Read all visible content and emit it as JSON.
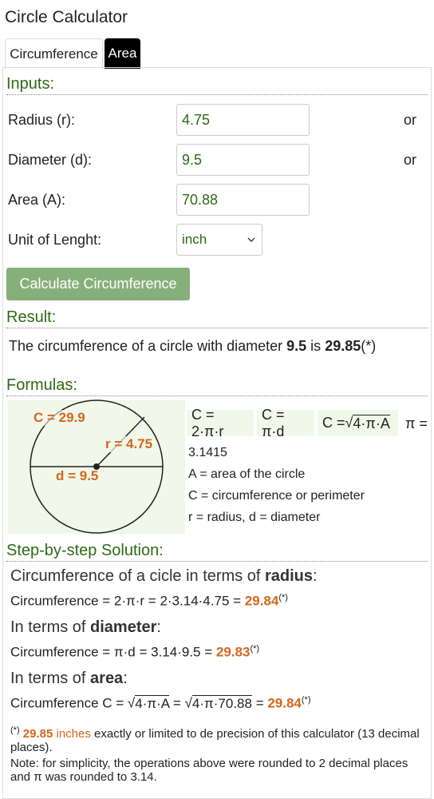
{
  "app": {
    "title": "Circle Calculator"
  },
  "tabs": [
    {
      "label": "Circumference",
      "active": true
    },
    {
      "label": "Area",
      "active": false
    }
  ],
  "inputs": {
    "heading": "Inputs:",
    "radius": {
      "label": "Radius (r):",
      "value": "4.75"
    },
    "diameter": {
      "label": "Diameter (d):",
      "value": "9.5"
    },
    "area": {
      "label": "Area (A):",
      "value": "70.88"
    },
    "unit": {
      "label": "Unit of Lenght:",
      "value": "inch"
    },
    "or_label": "or",
    "calc_button": "Calculate Circumference"
  },
  "result": {
    "heading": "Result:",
    "prefix": "The circumference of a circle with diameter ",
    "diameter": "9.5",
    "mid": " is ",
    "value": "29.85",
    "mark": "(*)"
  },
  "formulas": {
    "heading": "Formulas:",
    "diagram": {
      "c_label": "C = 29.9",
      "r_label": "r = 4.75",
      "d_label": "d = 9.5"
    },
    "f1": "C = 2·π·r",
    "f2": "C = π·d",
    "f3_prefix": "C = ",
    "f3_root": "√",
    "f3_body": "4·π·A",
    "pi_label": "π =",
    "pi_value": "3.1415",
    "desc_a": "A = area of the circle",
    "desc_c": "C = circumference or perimeter",
    "desc_rd": "r = radius, d = diameter"
  },
  "solution": {
    "heading": "Step-by-step Solution:",
    "radius_head_prefix": "Circumference of a cicle in terms of ",
    "radius_head_bold": "radius",
    "radius_head_suffix": ":",
    "radius_line": "Circumference = 2·π·r = 2·3.14·4.75 = ",
    "radius_result": "29.84",
    "diam_head_prefix": "In terms of ",
    "diam_head_bold": "diameter",
    "diam_head_suffix": ":",
    "diam_line": "Circumference = π·d = 3.14·9.5 = ",
    "diam_result": "29.83",
    "area_head_prefix": "In terms of ",
    "area_head_bold": "area",
    "area_head_suffix": ":",
    "area_line_prefix": "Circumference C = ",
    "area_root1": "√",
    "area_body1": "4·π·A",
    "area_eq": " = ",
    "area_root2": "√",
    "area_body2": "4·π·70.88",
    "area_eq2": " = ",
    "area_result": "29.84",
    "mark": "(*)"
  },
  "notes": {
    "mark": "(*)",
    "value": "29.85",
    "unit": "inches",
    "text1": " exactly or limited to de precision of this calculator (13 decimal places).",
    "text2": "Note: for simplicity, the operations above were rounded to 2 decimal places and π was rounded to 3.14."
  },
  "colors": {
    "heading": "#2e6a14",
    "accent_orange": "#d4661d",
    "button": "#86b07a",
    "formula_bg": "#f1f8ea"
  }
}
